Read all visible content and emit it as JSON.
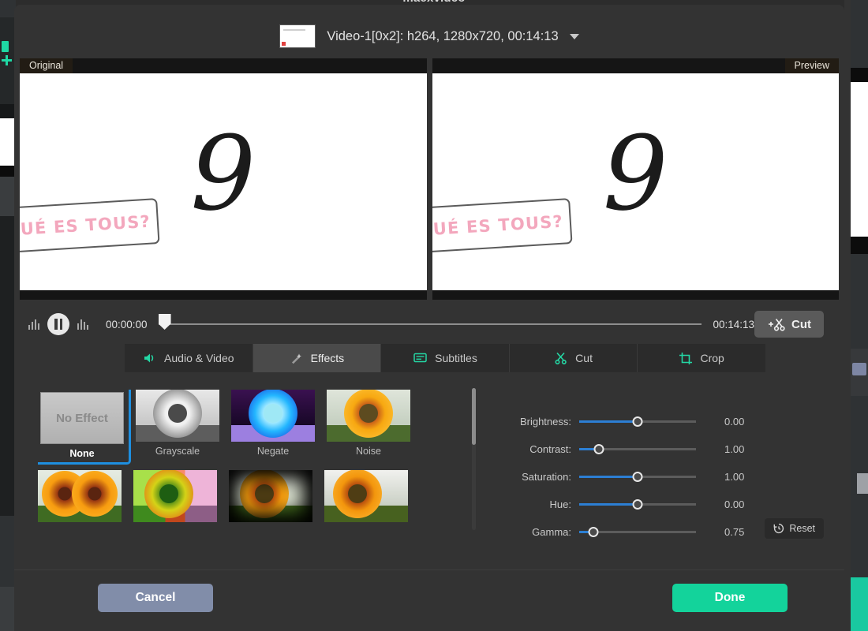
{
  "app": {
    "title": "macxvideo"
  },
  "header": {
    "file_title": "Video-1[0x2]: h264, 1280x720, 00:14:13",
    "dropdown_icon": "chevron-down-icon",
    "thumbnail_icon": "video-thumbnail"
  },
  "previews": {
    "original_label": "Original",
    "preview_label": "Preview",
    "video_text": "UÉ ES TOUS?",
    "video_glyph": "9"
  },
  "playback": {
    "pause_icon": "pause-icon",
    "current_time": "00:00:00",
    "total_time": "00:14:13",
    "cut_label": "Cut",
    "cut_icon": "scissors-plus-icon",
    "playhead_percent": 0
  },
  "tabs": [
    {
      "label": "Audio & Video",
      "icon": "speaker-icon",
      "active": false
    },
    {
      "label": "Effects",
      "icon": "magic-wand-icon",
      "active": true
    },
    {
      "label": "Subtitles",
      "icon": "subtitles-icon",
      "active": false
    },
    {
      "label": "Cut",
      "icon": "scissors-icon",
      "active": false
    },
    {
      "label": "Crop",
      "icon": "crop-icon",
      "active": false
    }
  ],
  "effects": {
    "items": [
      {
        "label": "None",
        "thumb_text": "No Effect",
        "selected": true,
        "style": "none"
      },
      {
        "label": "Grayscale",
        "thumb_text": "",
        "selected": false,
        "style": "grayscale"
      },
      {
        "label": "Negate",
        "thumb_text": "",
        "selected": false,
        "style": "negate"
      },
      {
        "label": "Noise",
        "thumb_text": "",
        "selected": false,
        "style": "noise"
      },
      {
        "label": "",
        "thumb_text": "",
        "selected": false,
        "style": "mirror"
      },
      {
        "label": "",
        "thumb_text": "",
        "selected": false,
        "style": "painting"
      },
      {
        "label": "",
        "thumb_text": "",
        "selected": false,
        "style": "vignette"
      },
      {
        "label": "",
        "thumb_text": "",
        "selected": false,
        "style": "sketch"
      }
    ],
    "scrollbar": "effects-scrollbar"
  },
  "adjustments": {
    "rows": [
      {
        "label": "Brightness:",
        "value": "0.00",
        "percent": 50
      },
      {
        "label": "Contrast:",
        "value": "1.00",
        "percent": 17
      },
      {
        "label": "Saturation:",
        "value": "1.00",
        "percent": 50
      },
      {
        "label": "Hue:",
        "value": "0.00",
        "percent": 50
      },
      {
        "label": "Gamma:",
        "value": "0.75",
        "percent": 12
      }
    ],
    "reset_label": "Reset",
    "reset_icon": "restore-clock-icon"
  },
  "footer": {
    "cancel_label": "Cancel",
    "done_label": "Done"
  },
  "colors": {
    "accent_green": "#13d39b",
    "tab_icon_green": "#24d7a4",
    "slider_blue": "#2c7fd4",
    "selection_blue": "#1e8fe0",
    "cancel_gray": "#818da9",
    "dialog_bg": "#333333"
  }
}
